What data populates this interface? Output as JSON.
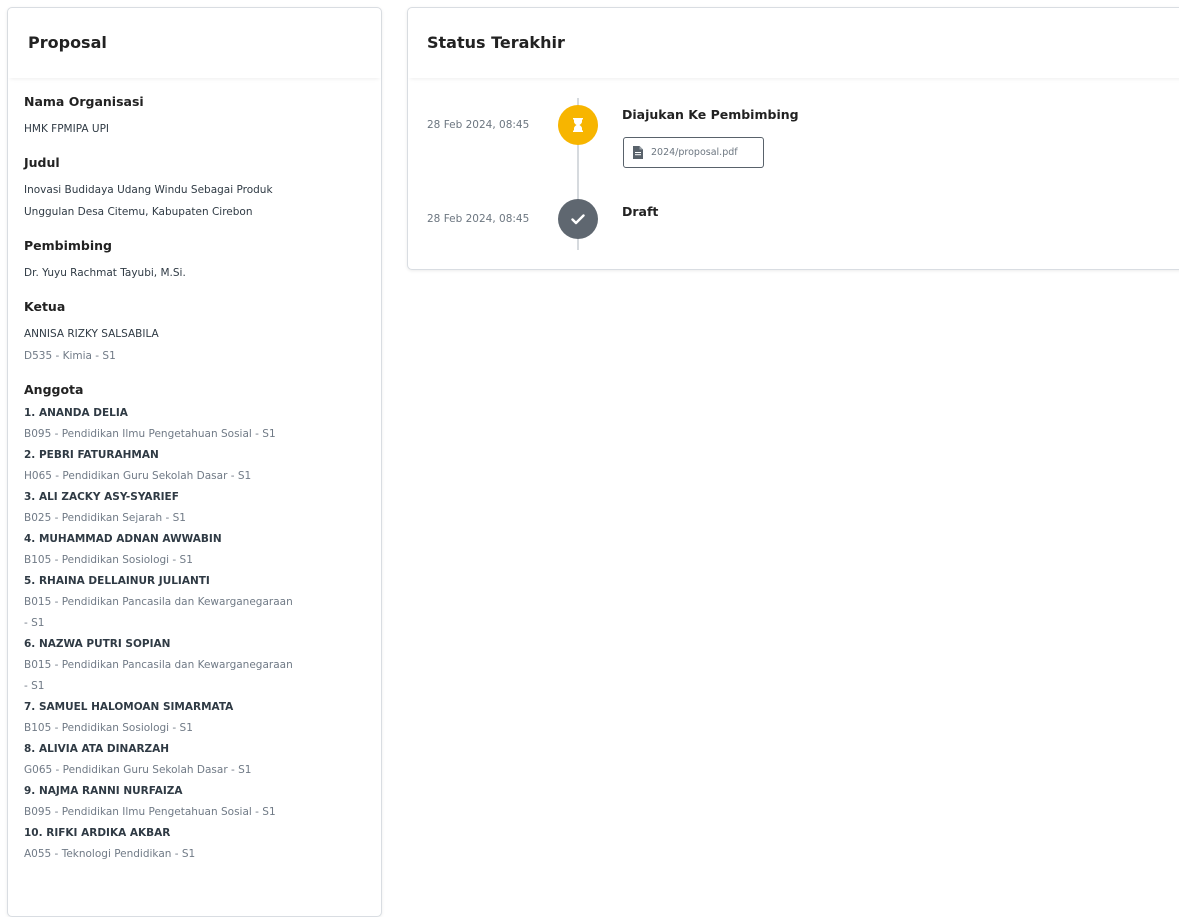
{
  "proposal": {
    "title": "Proposal",
    "org_label": "Nama Organisasi",
    "org_value": "HMK FPMIPA UPI",
    "judul_label": "Judul",
    "judul_line1": "Inovasi Budidaya Udang Windu Sebagai Produk",
    "judul_line2": "Unggulan Desa Citemu, Kabupaten Cirebon",
    "pembimbing_label": "Pembimbing",
    "pembimbing_value": "Dr. Yuyu Rachmat Tayubi, M.Si.",
    "ketua_label": "Ketua",
    "ketua_name": "ANNISA RIZKY SALSABILA",
    "ketua_sub": "D535 - Kimia - S1",
    "anggota_label": "Anggota",
    "members": [
      {
        "name": "1. ANANDA DELIA",
        "sub": "B095 - Pendidikan Ilmu Pengetahuan Sosial - S1"
      },
      {
        "name": "2. PEBRI FATURAHMAN",
        "sub": "H065 - Pendidikan Guru Sekolah Dasar - S1"
      },
      {
        "name": "3. ALI ZACKY ASY-SYARIEF",
        "sub": "B025 - Pendidikan Sejarah - S1"
      },
      {
        "name": "4. MUHAMMAD ADNAN AWWABIN",
        "sub": "B105 - Pendidikan Sosiologi - S1"
      },
      {
        "name": "5. RHAINA DELLAINUR JULIANTI",
        "sub": "B015 - Pendidikan Pancasila dan Kewarganegaraan",
        "sub2": "- S1"
      },
      {
        "name": "6. NAZWA PUTRI SOPIAN",
        "sub": "B015 - Pendidikan Pancasila dan Kewarganegaraan",
        "sub2": "- S1"
      },
      {
        "name": "7. SAMUEL HALOMOAN SIMARMATA",
        "sub": "B105 - Pendidikan Sosiologi - S1"
      },
      {
        "name": "8. ALIVIA ATA DINARZAH",
        "sub": "G065 - Pendidikan Guru Sekolah Dasar - S1"
      },
      {
        "name": "9. NAJMA RANNI NURFAIZA",
        "sub": "B095 - Pendidikan Ilmu Pengetahuan Sosial - S1"
      },
      {
        "name": "10. RIFKI ARDIKA AKBAR",
        "sub": "A055 - Teknologi Pendidikan - S1"
      }
    ]
  },
  "status": {
    "title": "Status Terakhir",
    "events": [
      {
        "time": "28 Feb 2024, 08:45",
        "title": "Diajukan Ke Pembimbing",
        "icon": "hourglass-icon",
        "color": "#f7b500",
        "file": "2024/proposal.pdf"
      },
      {
        "time": "28 Feb 2024, 08:45",
        "title": "Draft",
        "icon": "check-icon",
        "color": "#5f6770"
      }
    ]
  }
}
